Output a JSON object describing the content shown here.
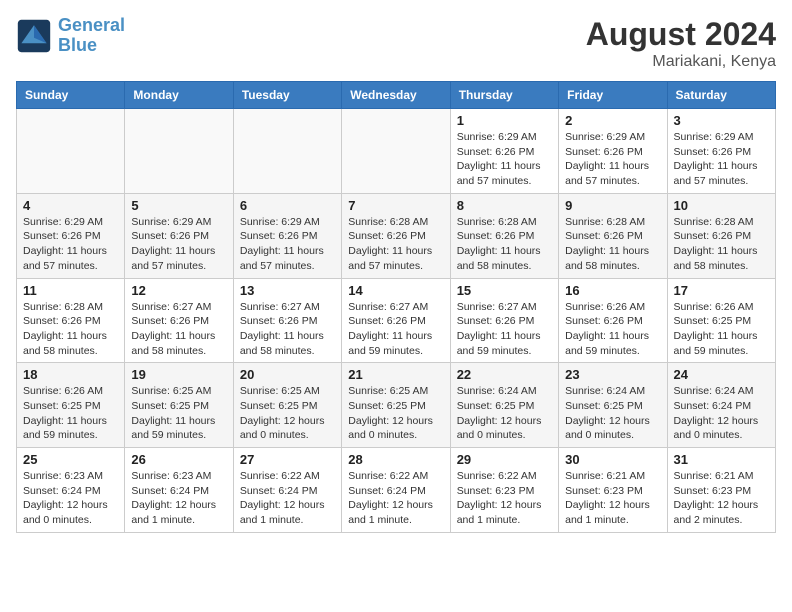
{
  "logo": {
    "line1": "General",
    "line2": "Blue"
  },
  "title": "August 2024",
  "location": "Mariakani, Kenya",
  "headers": [
    "Sunday",
    "Monday",
    "Tuesday",
    "Wednesday",
    "Thursday",
    "Friday",
    "Saturday"
  ],
  "weeks": [
    [
      {
        "day": "",
        "info": ""
      },
      {
        "day": "",
        "info": ""
      },
      {
        "day": "",
        "info": ""
      },
      {
        "day": "",
        "info": ""
      },
      {
        "day": "1",
        "info": "Sunrise: 6:29 AM\nSunset: 6:26 PM\nDaylight: 11 hours\nand 57 minutes."
      },
      {
        "day": "2",
        "info": "Sunrise: 6:29 AM\nSunset: 6:26 PM\nDaylight: 11 hours\nand 57 minutes."
      },
      {
        "day": "3",
        "info": "Sunrise: 6:29 AM\nSunset: 6:26 PM\nDaylight: 11 hours\nand 57 minutes."
      }
    ],
    [
      {
        "day": "4",
        "info": "Sunrise: 6:29 AM\nSunset: 6:26 PM\nDaylight: 11 hours\nand 57 minutes."
      },
      {
        "day": "5",
        "info": "Sunrise: 6:29 AM\nSunset: 6:26 PM\nDaylight: 11 hours\nand 57 minutes."
      },
      {
        "day": "6",
        "info": "Sunrise: 6:29 AM\nSunset: 6:26 PM\nDaylight: 11 hours\nand 57 minutes."
      },
      {
        "day": "7",
        "info": "Sunrise: 6:28 AM\nSunset: 6:26 PM\nDaylight: 11 hours\nand 57 minutes."
      },
      {
        "day": "8",
        "info": "Sunrise: 6:28 AM\nSunset: 6:26 PM\nDaylight: 11 hours\nand 58 minutes."
      },
      {
        "day": "9",
        "info": "Sunrise: 6:28 AM\nSunset: 6:26 PM\nDaylight: 11 hours\nand 58 minutes."
      },
      {
        "day": "10",
        "info": "Sunrise: 6:28 AM\nSunset: 6:26 PM\nDaylight: 11 hours\nand 58 minutes."
      }
    ],
    [
      {
        "day": "11",
        "info": "Sunrise: 6:28 AM\nSunset: 6:26 PM\nDaylight: 11 hours\nand 58 minutes."
      },
      {
        "day": "12",
        "info": "Sunrise: 6:27 AM\nSunset: 6:26 PM\nDaylight: 11 hours\nand 58 minutes."
      },
      {
        "day": "13",
        "info": "Sunrise: 6:27 AM\nSunset: 6:26 PM\nDaylight: 11 hours\nand 58 minutes."
      },
      {
        "day": "14",
        "info": "Sunrise: 6:27 AM\nSunset: 6:26 PM\nDaylight: 11 hours\nand 59 minutes."
      },
      {
        "day": "15",
        "info": "Sunrise: 6:27 AM\nSunset: 6:26 PM\nDaylight: 11 hours\nand 59 minutes."
      },
      {
        "day": "16",
        "info": "Sunrise: 6:26 AM\nSunset: 6:26 PM\nDaylight: 11 hours\nand 59 minutes."
      },
      {
        "day": "17",
        "info": "Sunrise: 6:26 AM\nSunset: 6:25 PM\nDaylight: 11 hours\nand 59 minutes."
      }
    ],
    [
      {
        "day": "18",
        "info": "Sunrise: 6:26 AM\nSunset: 6:25 PM\nDaylight: 11 hours\nand 59 minutes."
      },
      {
        "day": "19",
        "info": "Sunrise: 6:25 AM\nSunset: 6:25 PM\nDaylight: 11 hours\nand 59 minutes."
      },
      {
        "day": "20",
        "info": "Sunrise: 6:25 AM\nSunset: 6:25 PM\nDaylight: 12 hours\nand 0 minutes."
      },
      {
        "day": "21",
        "info": "Sunrise: 6:25 AM\nSunset: 6:25 PM\nDaylight: 12 hours\nand 0 minutes."
      },
      {
        "day": "22",
        "info": "Sunrise: 6:24 AM\nSunset: 6:25 PM\nDaylight: 12 hours\nand 0 minutes."
      },
      {
        "day": "23",
        "info": "Sunrise: 6:24 AM\nSunset: 6:25 PM\nDaylight: 12 hours\nand 0 minutes."
      },
      {
        "day": "24",
        "info": "Sunrise: 6:24 AM\nSunset: 6:24 PM\nDaylight: 12 hours\nand 0 minutes."
      }
    ],
    [
      {
        "day": "25",
        "info": "Sunrise: 6:23 AM\nSunset: 6:24 PM\nDaylight: 12 hours\nand 0 minutes."
      },
      {
        "day": "26",
        "info": "Sunrise: 6:23 AM\nSunset: 6:24 PM\nDaylight: 12 hours\nand 1 minute."
      },
      {
        "day": "27",
        "info": "Sunrise: 6:22 AM\nSunset: 6:24 PM\nDaylight: 12 hours\nand 1 minute."
      },
      {
        "day": "28",
        "info": "Sunrise: 6:22 AM\nSunset: 6:24 PM\nDaylight: 12 hours\nand 1 minute."
      },
      {
        "day": "29",
        "info": "Sunrise: 6:22 AM\nSunset: 6:23 PM\nDaylight: 12 hours\nand 1 minute."
      },
      {
        "day": "30",
        "info": "Sunrise: 6:21 AM\nSunset: 6:23 PM\nDaylight: 12 hours\nand 1 minute."
      },
      {
        "day": "31",
        "info": "Sunrise: 6:21 AM\nSunset: 6:23 PM\nDaylight: 12 hours\nand 2 minutes."
      }
    ]
  ]
}
